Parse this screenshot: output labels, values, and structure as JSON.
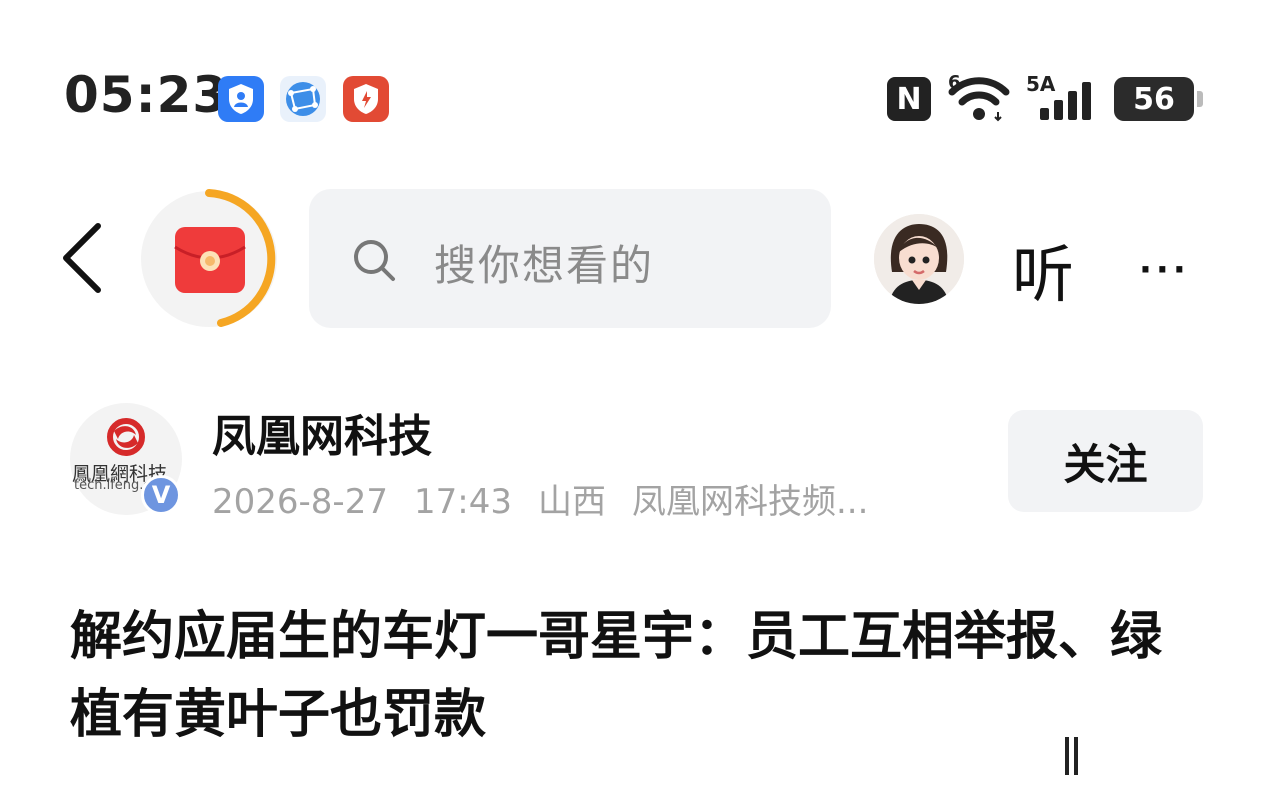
{
  "status_bar": {
    "time": "05:23",
    "apps": [
      "account-shield-icon",
      "globe-network-icon",
      "security-shield-icon"
    ],
    "nfc": "N",
    "wifi_tag": "6",
    "signal_tag": "5A",
    "battery": "56"
  },
  "nav": {
    "search_placeholder": "搜你想看的",
    "listen_label": "听",
    "more_label": "···",
    "accent_color": "#f5a623"
  },
  "publisher": {
    "name": "凤凰网科技",
    "logo_text": "鳳凰網科技",
    "logo_sub": "tech.ifeng.com",
    "verified": "V",
    "date": "2026-8-27",
    "time": "17:43",
    "location": "山西",
    "channel": "凤凰网科技频...",
    "follow_label": "关注"
  },
  "article": {
    "headline": "解约应届生的车灯一哥星宇：员工互相举报、绿植有黄叶子也罚款"
  }
}
